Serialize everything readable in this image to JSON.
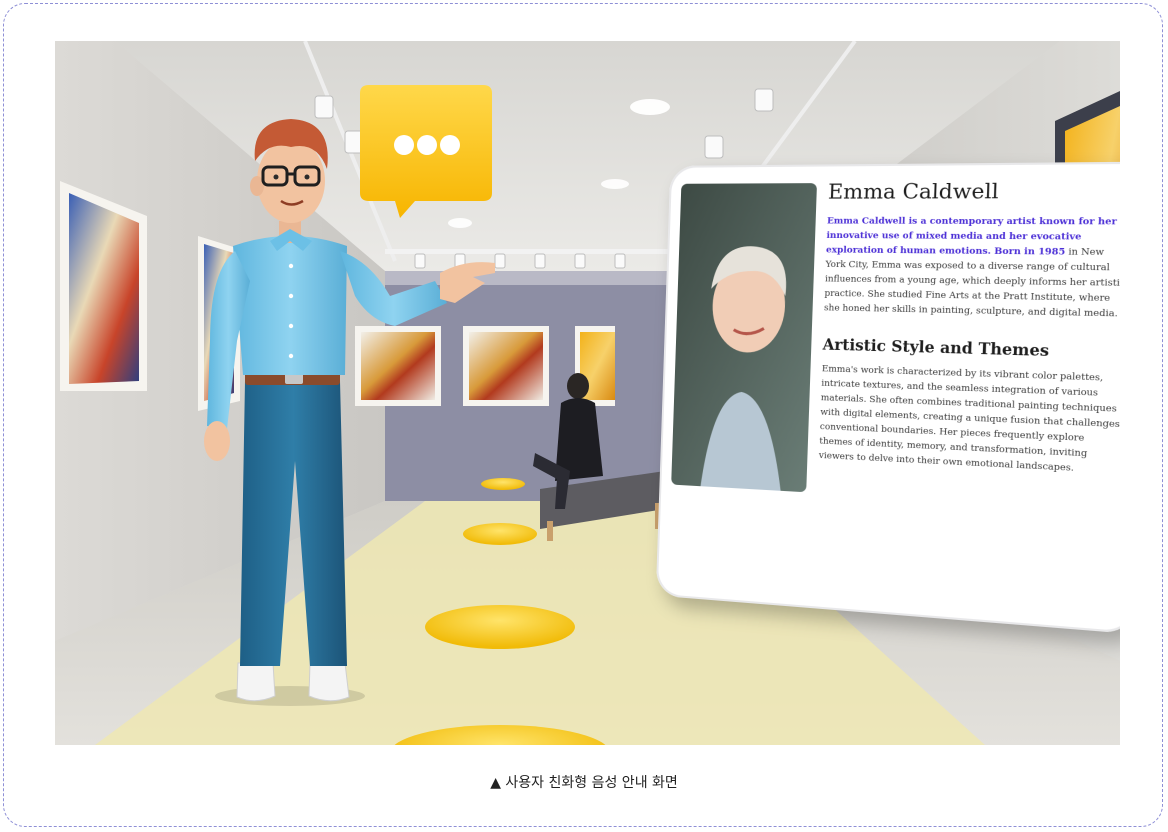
{
  "caption": "▲ 사용자 친화형 음성 안내 화면",
  "speech_bubble_icon": "ellipsis-chat-icon",
  "panel": {
    "name": "Emma Caldwell",
    "bio_highlight": "Emma Caldwell is a contemporary artist known for her innovative use of mixed media and her evocative exploration of human emotions. Born in 1985",
    "bio_rest": " in New York City, Emma was exposed to a diverse range of cultural influences from a young age, which deeply informs her artistic practice. She studied Fine Arts at the Pratt Institute, where she honed her skills in painting, sculpture, and digital media.",
    "section_title": "Artistic Style and Themes",
    "section_body": "Emma's work is characterized by its vibrant color palettes, intricate textures, and the seamless integration of various materials. She often combines traditional painting techniques with digital elements, creating a unique fusion that challenges conventional boundaries. Her pieces frequently explore themes of identity, memory, and transformation, inviting viewers to delve into their own emotional landscapes."
  },
  "colors": {
    "accent_yellow": "#ffcf1f",
    "highlight_text": "#4b2fd6",
    "frame_border": "#8e8fd6"
  }
}
